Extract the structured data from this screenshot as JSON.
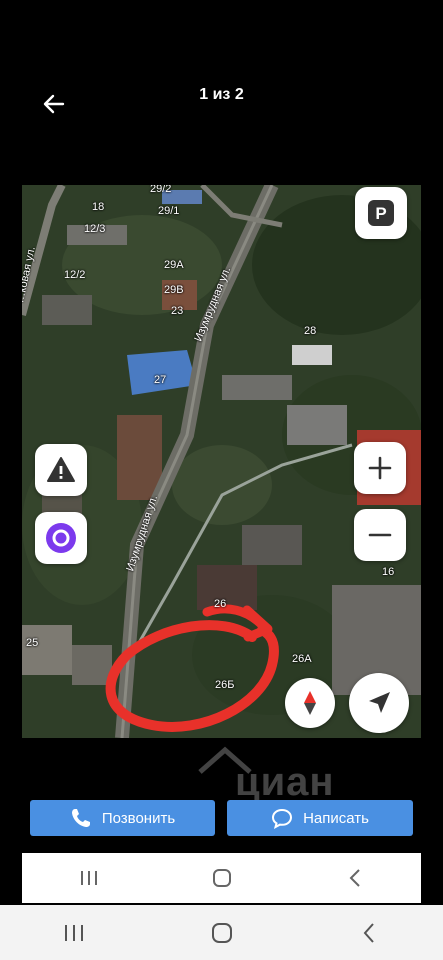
{
  "header": {
    "counter": "1 из 2",
    "back_icon": "arrow-left-icon"
  },
  "map": {
    "building_numbers": [
      "29/2",
      "18",
      "12/3",
      "29/1",
      "12/2",
      "29А",
      "29В",
      "23",
      "28",
      "27",
      "26",
      "26А",
      "26Б",
      "25",
      "16"
    ],
    "streets": [
      "Изумрудная ул.",
      "Изумрудная ул.",
      "…ковая ул."
    ],
    "parking_label": "P",
    "controls": {
      "zoom_in": "+",
      "zoom_out": "−"
    },
    "icons": [
      "parking-icon",
      "warning-icon",
      "alice-assistant-icon",
      "zoom-in-icon",
      "zoom-out-icon",
      "compass-icon",
      "location-arrow-icon"
    ]
  },
  "actions": {
    "call": "Позвонить",
    "message": "Написать"
  },
  "watermark": {
    "brand": "циан"
  },
  "colors": {
    "accent": "#4a90e2",
    "highlight": "#e8312a",
    "background": "#000000"
  }
}
